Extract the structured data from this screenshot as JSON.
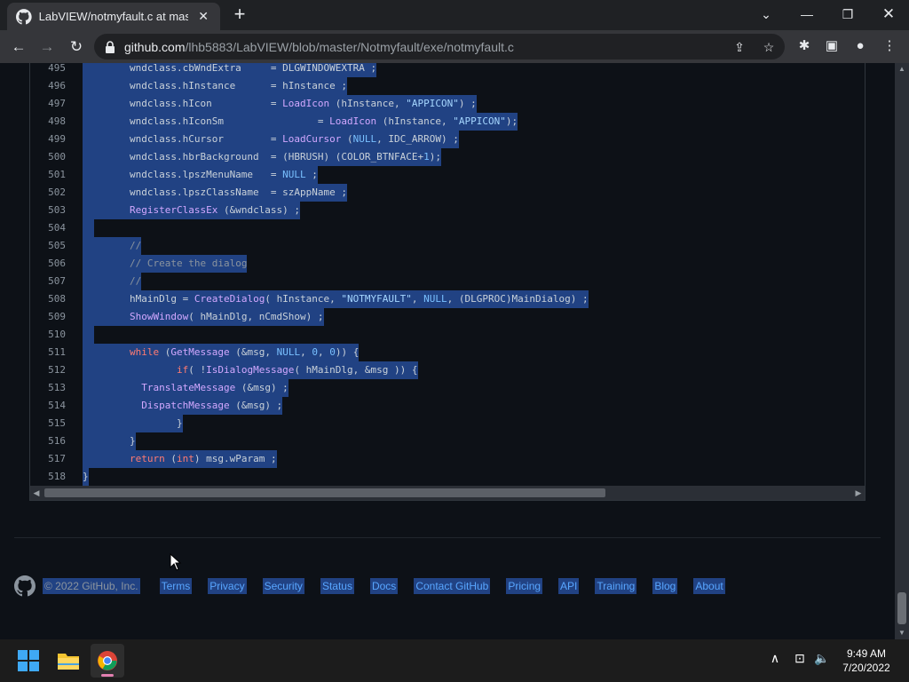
{
  "browser": {
    "tab_title": "LabVIEW/notmyfault.c at master",
    "tab_close": "✕",
    "new_tab": "+",
    "url_host": "github.com",
    "url_path": "/lhb5883/LabVIEW/blob/master/Notmyfault/exe/notmyfault.c"
  },
  "code": {
    "lines": [
      {
        "n": "495",
        "html": "        wndclass.cbWndExtra     = DLGWINDOWEXTRA ;"
      },
      {
        "n": "496",
        "html": "        wndclass.hInstance      = hInstance ;"
      },
      {
        "n": "497",
        "html": "        wndclass.hIcon          = <span class=\"fn\">LoadIcon</span> (hInstance, <span class=\"st\">\"APPICON\"</span>) ;"
      },
      {
        "n": "498",
        "html": "        wndclass.hIconSm                = <span class=\"fn\">LoadIcon</span> (hInstance, <span class=\"st\">\"APPICON\"</span>);"
      },
      {
        "n": "499",
        "html": "        wndclass.hCursor        = <span class=\"fn\">LoadCursor</span> (<span class=\"cn\">NULL</span>, IDC_ARROW) ;"
      },
      {
        "n": "500",
        "html": "        wndclass.hbrBackground  = (HBRUSH) (COLOR_BTNFACE+<span class=\"cn\">1</span>);"
      },
      {
        "n": "501",
        "html": "        wndclass.lpszMenuName   = <span class=\"cn\">NULL</span> ;"
      },
      {
        "n": "502",
        "html": "        wndclass.lpszClassName  = szAppName ;"
      },
      {
        "n": "503",
        "html": "        <span class=\"fn\">RegisterClassEx</span> (&amp;wndclass) ;"
      },
      {
        "n": "504",
        "html": "  "
      },
      {
        "n": "505",
        "html": "        <span class=\"cm\">//</span>"
      },
      {
        "n": "506",
        "html": "        <span class=\"cm\">// Create the dialog</span>"
      },
      {
        "n": "507",
        "html": "        <span class=\"cm\">//</span>"
      },
      {
        "n": "508",
        "html": "        hMainDlg = <span class=\"fn\">CreateDialog</span>( hInstance, <span class=\"st\">\"NOTMYFAULT\"</span>, <span class=\"cn\">NULL</span>, (DLGPROC)MainDialog) ;"
      },
      {
        "n": "509",
        "html": "        <span class=\"fn\">ShowWindow</span>( hMainDlg, nCmdShow) ;"
      },
      {
        "n": "510",
        "html": "  "
      },
      {
        "n": "511",
        "html": "        <span class=\"kw\">while</span> (<span class=\"fn\">GetMessage</span> (&amp;msg, <span class=\"cn\">NULL</span>, <span class=\"cn\">0</span>, <span class=\"cn\">0</span>)) {"
      },
      {
        "n": "512",
        "html": "                <span class=\"kw\">if</span>( !<span class=\"fn\">IsDialogMessage</span>( hMainDlg, &amp;msg )) {"
      },
      {
        "n": "513",
        "html": "          <span class=\"fn\">TranslateMessage</span> (&amp;msg) ;"
      },
      {
        "n": "514",
        "html": "          <span class=\"fn\">DispatchMessage</span> (&amp;msg) ;"
      },
      {
        "n": "515",
        "html": "                }"
      },
      {
        "n": "516",
        "html": "        }"
      },
      {
        "n": "517",
        "html": "        <span class=\"kw\">return</span> (<span class=\"kw\">int</span>) msg.wParam ;"
      },
      {
        "n": "518",
        "html": "}"
      }
    ]
  },
  "footer": {
    "copyright": "© 2022 GitHub, Inc.",
    "links": [
      "Terms",
      "Privacy",
      "Security",
      "Status",
      "Docs",
      "Contact GitHub",
      "Pricing",
      "API",
      "Training",
      "Blog",
      "About"
    ]
  },
  "taskbar": {
    "time": "9:49 AM",
    "date": "7/20/2022"
  },
  "colors": {
    "page_bg": "#0d1117",
    "selection": "#214283",
    "link": "#58a6ff",
    "chrome_tab": "#35363a",
    "chrome_frame": "#1f2124"
  }
}
